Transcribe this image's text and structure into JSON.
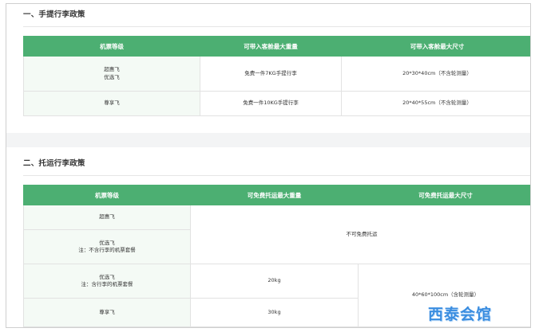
{
  "carry_on": {
    "title": "一、手提行李政策",
    "headers": [
      "机票等级",
      "可带入客舱最大重量",
      "可带入客舱最大尺寸"
    ],
    "rows": [
      {
        "grade_1": "超惠飞",
        "grade_2": "优选飞",
        "weight": "免费一件7KG手提行李",
        "size": "20*30*40cm（不含轮测量）"
      },
      {
        "grade_1": "尊享飞",
        "grade_2": "",
        "weight": "免费一件10KG手提行李",
        "size": "20*40*55cm（不含轮测量）"
      }
    ]
  },
  "checked": {
    "title": "二、托运行李政策",
    "headers": [
      "机票等级",
      "可免费托运最大重量",
      "可免费托运最大尺寸"
    ],
    "grades": [
      {
        "line1": "超惠飞",
        "line2": ""
      },
      {
        "line1": "优选飞",
        "line2": "注：不含行李的机票套餐"
      },
      {
        "line1": "优选飞",
        "line2": "注：含行李的机票套餐"
      },
      {
        "line1": "尊享飞",
        "line2": ""
      }
    ],
    "no_free": "不可免费托运",
    "weights": [
      "20kg",
      "30kg"
    ],
    "size": "40*60*100cm（含轮测量）"
  },
  "watermark": "西泰会馆"
}
